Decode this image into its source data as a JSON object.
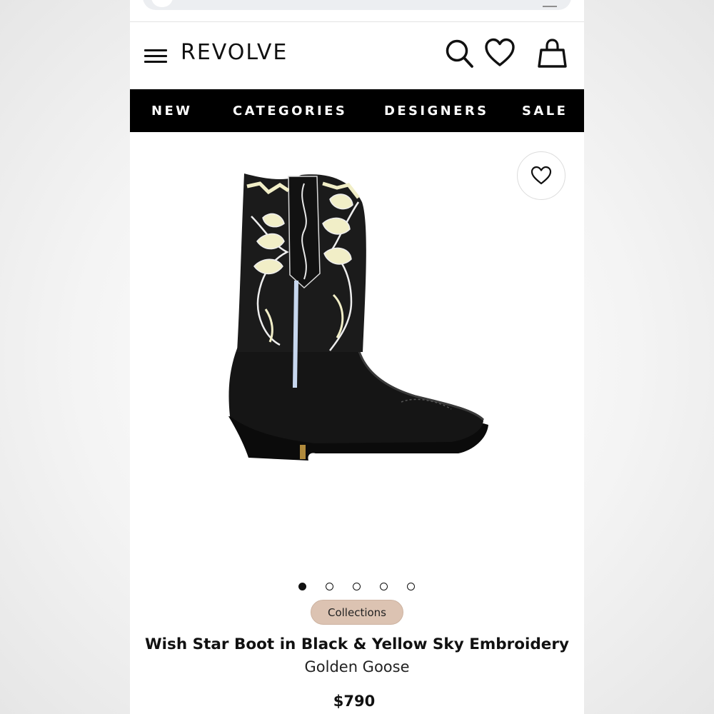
{
  "header": {
    "logo": "REVOLVE"
  },
  "nav": {
    "items": [
      {
        "label": "NEW"
      },
      {
        "label": "CATEGORIES"
      },
      {
        "label": "DESIGNERS"
      },
      {
        "label": "SALE"
      }
    ]
  },
  "icons": {
    "menu": "hamburger-menu-icon",
    "search": "search-icon",
    "wishlist": "heart-icon",
    "bag": "shopping-bag-icon"
  },
  "gallery": {
    "image_count": 5,
    "active_index": 0
  },
  "product": {
    "badge": "Collections",
    "title": "Wish Star Boot in Black & Yellow Sky Embroidery",
    "brand": "Golden Goose",
    "price": "$790"
  },
  "colors": {
    "nav_background": "#000000",
    "badge_background": "#dcc3b2",
    "text": "#111111"
  }
}
